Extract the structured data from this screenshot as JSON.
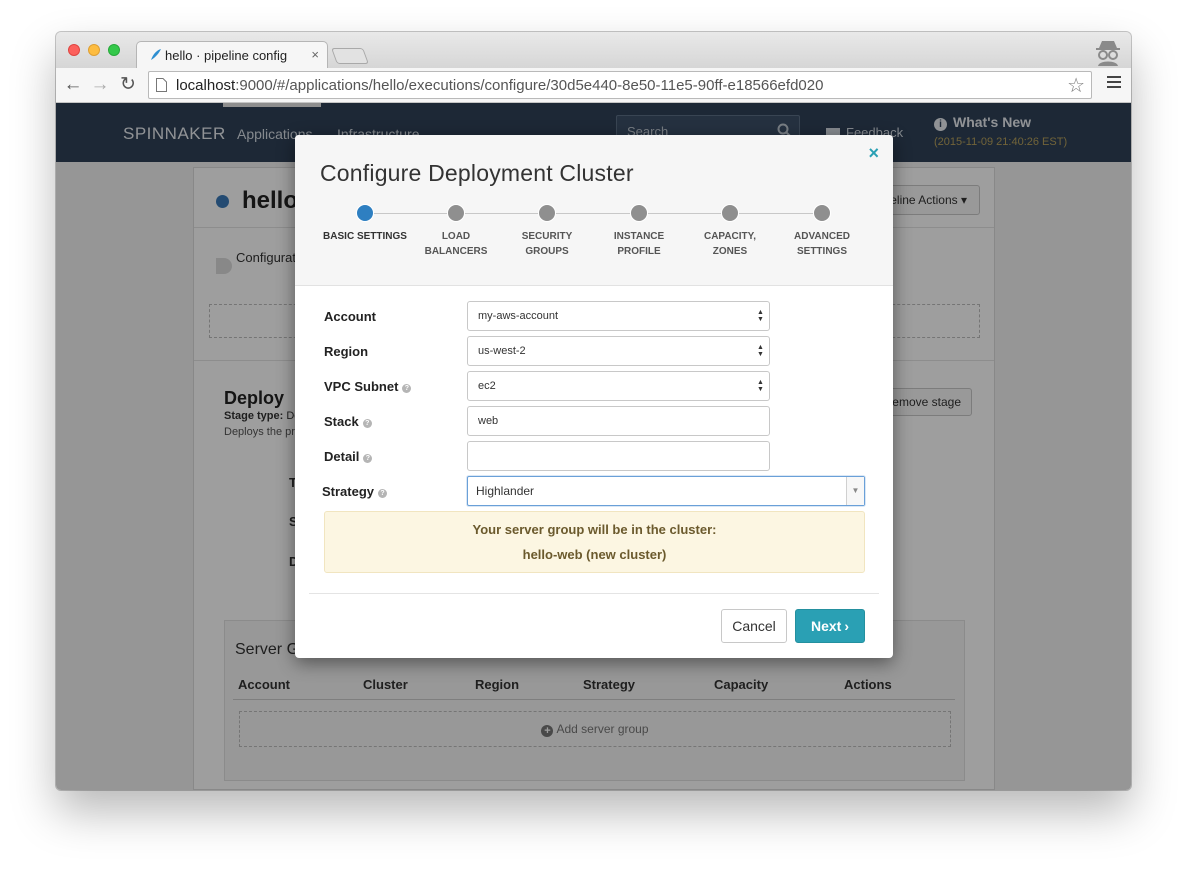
{
  "browser": {
    "tab_title": "hello · pipeline config",
    "tab_close": "×",
    "url_host": "localhost",
    "url_rest": ":9000/#/applications/hello/executions/configure/30d5e440-8e50-11e5-90ff-e18566efd020"
  },
  "app_nav": {
    "brand": "SPINNAKER",
    "links": [
      "Applications",
      "Infrastructure"
    ],
    "search_placeholder": "Search",
    "feedback": "Feedback",
    "whats_new_title": "What's New",
    "whats_new_date": "(2015-11-09 21:40:26 EST)"
  },
  "pipeline": {
    "name": "hello",
    "actions_label": "Pipeline Actions",
    "config_label": "Configuration",
    "stage_title": "Deploy",
    "stage_type_label": "Stage type:",
    "stage_type_value": "Deploy",
    "stage_description": "Deploys the previously baked or found image",
    "remove_stage": "Remove stage",
    "side_letters": [
      "T",
      "S",
      "D"
    ]
  },
  "server_groups": {
    "title": "Server Groups",
    "columns": [
      "Account",
      "Cluster",
      "Region",
      "Strategy",
      "Capacity",
      "Actions"
    ],
    "add_label": "Add server group"
  },
  "modal": {
    "title": "Configure Deployment Cluster",
    "close": "×",
    "steps": [
      {
        "line1": "BASIC SETTINGS",
        "line2": ""
      },
      {
        "line1": "LOAD",
        "line2": "BALANCERS"
      },
      {
        "line1": "SECURITY",
        "line2": "GROUPS"
      },
      {
        "line1": "INSTANCE",
        "line2": "PROFILE"
      },
      {
        "line1": "CAPACITY,",
        "line2": "ZONES"
      },
      {
        "line1": "ADVANCED",
        "line2": "SETTINGS"
      }
    ],
    "active_step": 0,
    "fields": {
      "account": {
        "label": "Account",
        "value": "my-aws-account"
      },
      "region": {
        "label": "Region",
        "value": "us-west-2"
      },
      "vpc_subnet": {
        "label": "VPC Subnet",
        "value": "ec2"
      },
      "stack": {
        "label": "Stack",
        "value": "web"
      },
      "detail": {
        "label": "Detail",
        "value": ""
      },
      "strategy": {
        "label": "Strategy",
        "value": "Highlander"
      }
    },
    "cluster_note_line1": "Your server group will be in the cluster:",
    "cluster_note_line2": "hello-web (new cluster)",
    "cancel_label": "Cancel",
    "next_label": "Next"
  },
  "colors": {
    "nav_bg": "#2f4258",
    "accent": "#2aa0b4",
    "active_step": "#2e7fc1",
    "note_bg": "#fcf6e2"
  }
}
